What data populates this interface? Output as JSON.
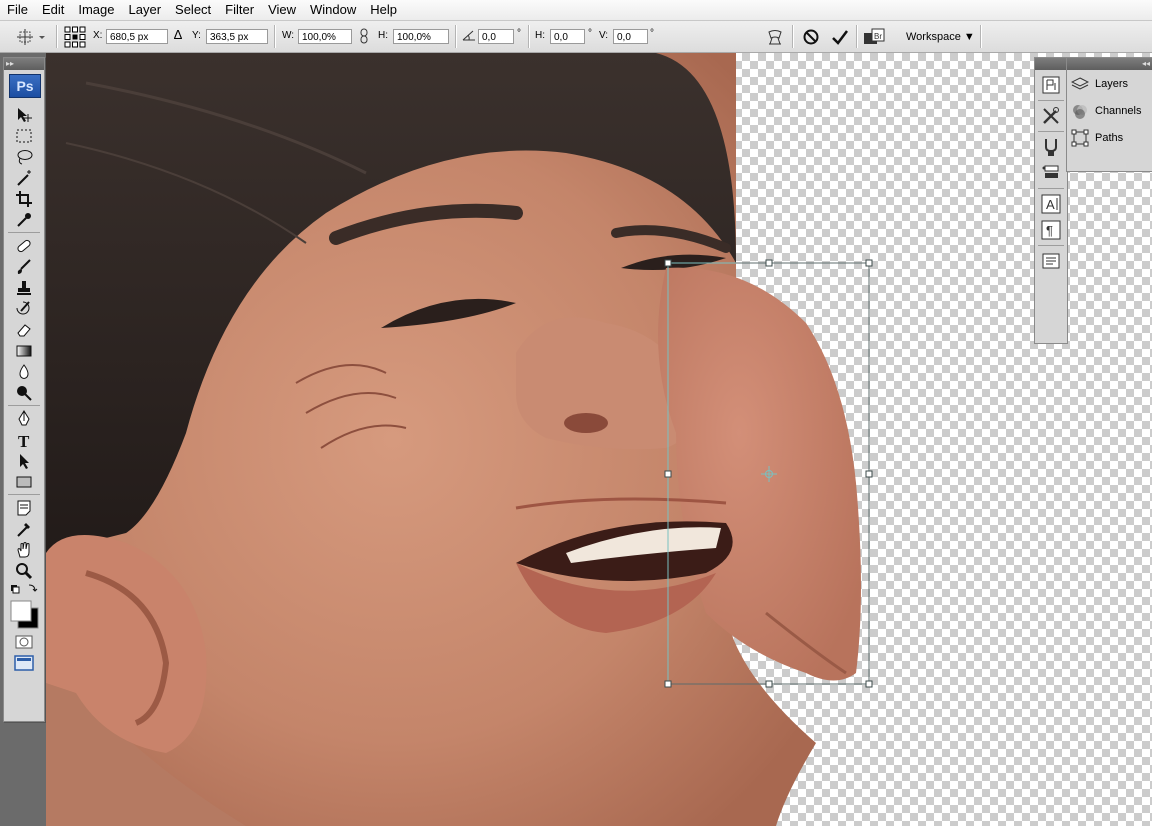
{
  "menu": [
    "File",
    "Edit",
    "Image",
    "Layer",
    "Select",
    "Filter",
    "View",
    "Window",
    "Help"
  ],
  "options": {
    "x_label": "X:",
    "x_value": "680,5 px",
    "y_label": "Y:",
    "y_value": "363,5 px",
    "w_label": "W:",
    "w_value": "100,0%",
    "h_label": "H:",
    "h_value": "100,0%",
    "rot_value": "0,0",
    "deg": "°",
    "hskew_label": "H:",
    "hskew_value": "0,0",
    "vskew_label": "V:",
    "vskew_value": "0,0",
    "workspace_label": "Workspace ▼"
  },
  "toolbox": {
    "logo": "Ps"
  },
  "panels": {
    "items": [
      {
        "label": "Layers",
        "icon": "layers-icon"
      },
      {
        "label": "Channels",
        "icon": "channels-icon"
      },
      {
        "label": "Paths",
        "icon": "paths-icon"
      }
    ]
  },
  "colors": {
    "selection_box": "#5d6b6b",
    "anchor_handle": "#79c1c1",
    "checker_dark": "#cccccc",
    "checker_light": "#ffffff",
    "skin_tone": "#c88a70",
    "hair_tone": "#2e2624"
  }
}
